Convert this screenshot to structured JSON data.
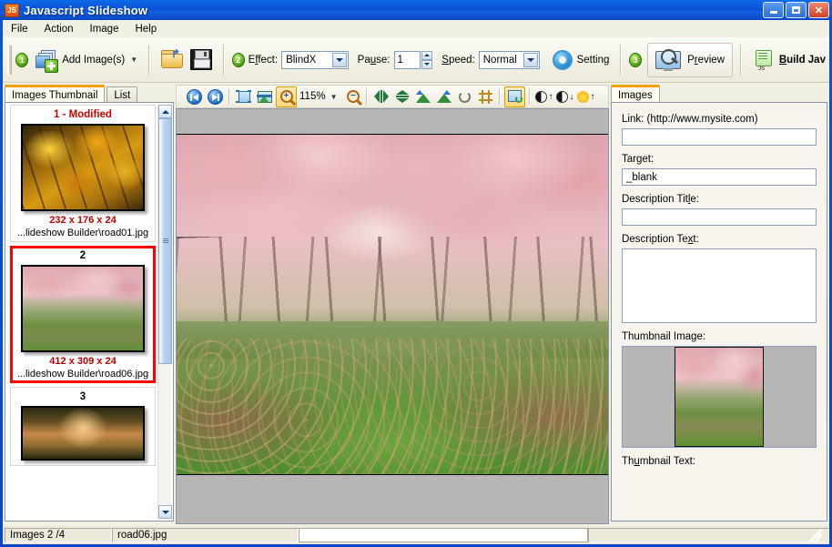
{
  "window": {
    "title": "Javascript Slideshow",
    "icon": "js-app-icon",
    "minimize_label": "Minimize",
    "maximize_label": "Maximize",
    "close_label": "Close"
  },
  "menubar": {
    "items": [
      {
        "label": "File"
      },
      {
        "label": "Action"
      },
      {
        "label": "Image"
      },
      {
        "label": "Help"
      }
    ]
  },
  "toolbar": {
    "step1_badge": "1",
    "add_images_label": "Add Image(s)",
    "open_tooltip": "Open",
    "save_tooltip": "Save",
    "step2_badge": "2",
    "effect_label": "Effect:",
    "effect_value": "BlindX",
    "pause_label": "Pause:",
    "pause_value": "1",
    "speed_label": "Speed:",
    "speed_value": "Normal",
    "setting_label": "Setting",
    "step3_badge": "3",
    "preview_label": "Preview",
    "build_label": "Build Jav"
  },
  "left_panel": {
    "tabs": [
      {
        "label": "Images Thumbnail",
        "active": true
      },
      {
        "label": "List",
        "active": false
      }
    ],
    "thumbnails": [
      {
        "number": "1 - Modified",
        "modified": true,
        "selected": false,
        "dimensions": "232 x 176 x 24",
        "path": "...lideshow Builder\\road01.jpg",
        "image": "autumn-golden-foliage"
      },
      {
        "number": "2",
        "modified": false,
        "selected": true,
        "dimensions": "412 x 309 x 24",
        "path": "...lideshow Builder\\road06.jpg",
        "image": "cherry-blossom-path"
      },
      {
        "number": "3",
        "modified": false,
        "selected": false,
        "dimensions": "",
        "path": "",
        "image": "sunset-tree-lane"
      }
    ]
  },
  "image_toolbar": {
    "first_tooltip": "First Image",
    "next_tooltip": "Next Image",
    "fit_tooltip": "Fit To Window",
    "actual_tooltip": "Actual Size",
    "zoom_in_tooltip": "Zoom In",
    "zoom_value": "115%",
    "zoom_out_tooltip": "Zoom Out",
    "flip_h_tooltip": "Flip Horizontal",
    "flip_v_tooltip": "Flip Vertical",
    "rotate_left_tooltip": "Rotate Left",
    "rotate_right_tooltip": "Rotate Right",
    "rotate_free_tooltip": "Rotate Free",
    "crop_tooltip": "Crop",
    "resize_tooltip": "Resize",
    "contrast_up_tooltip": "Increase Contrast",
    "contrast_down_tooltip": "Decrease Contrast",
    "brightness_tooltip": "Brightness"
  },
  "right_panel": {
    "tabs": [
      {
        "label": "Images",
        "active": true
      }
    ],
    "link_label": "Link: (http://www.mysite.com)",
    "link_value": "",
    "target_label": "Target:",
    "target_value": "_blank",
    "desc_title_label": "Description Title:",
    "desc_title_value": "",
    "desc_text_label": "Description Text:",
    "desc_text_value": "",
    "thumbnail_image_label": "Thumbnail Image:",
    "thumbnail_text_label": "Thumbnail Text:"
  },
  "statusbar": {
    "images_count": "Images 2 /4",
    "current_file": "road06.jpg",
    "field_value": "",
    "extra": ""
  },
  "colors": {
    "title_blue": "#0a52d8",
    "accent_orange": "#f2a000",
    "selected_red": "#ff0000",
    "modified_red": "#d10000",
    "dim_red": "#c00000",
    "panel_bg": "#f1f0e4",
    "viewer_bg": "#b6b6b6"
  }
}
